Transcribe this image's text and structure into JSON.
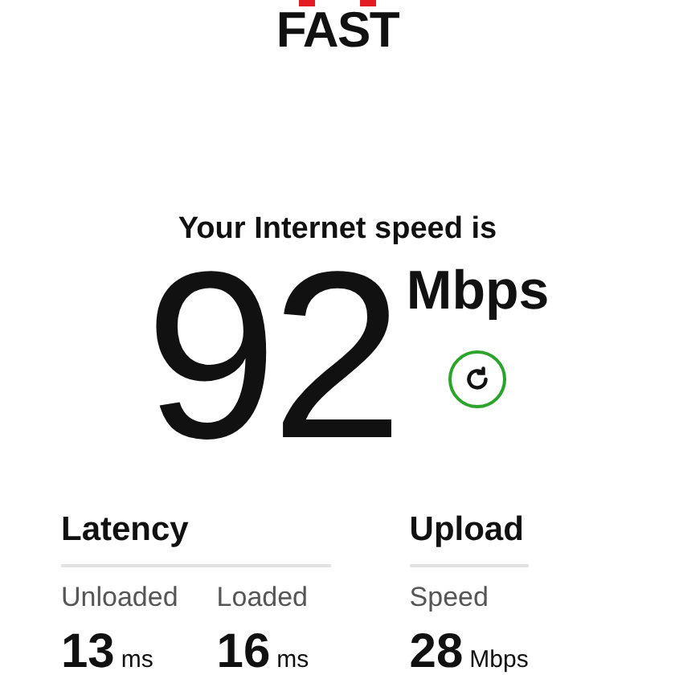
{
  "logo": {
    "text": "FAST"
  },
  "headline": "Your Internet speed is",
  "speed": {
    "value": "92",
    "unit": "Mbps"
  },
  "sections": [
    {
      "title": "Latency",
      "metrics": [
        {
          "label": "Unloaded",
          "value": "13",
          "unit": "ms"
        },
        {
          "label": "Loaded",
          "value": "16",
          "unit": "ms"
        }
      ]
    },
    {
      "title": "Upload",
      "metrics": [
        {
          "label": "Speed",
          "value": "28",
          "unit": "Mbps"
        }
      ]
    }
  ]
}
